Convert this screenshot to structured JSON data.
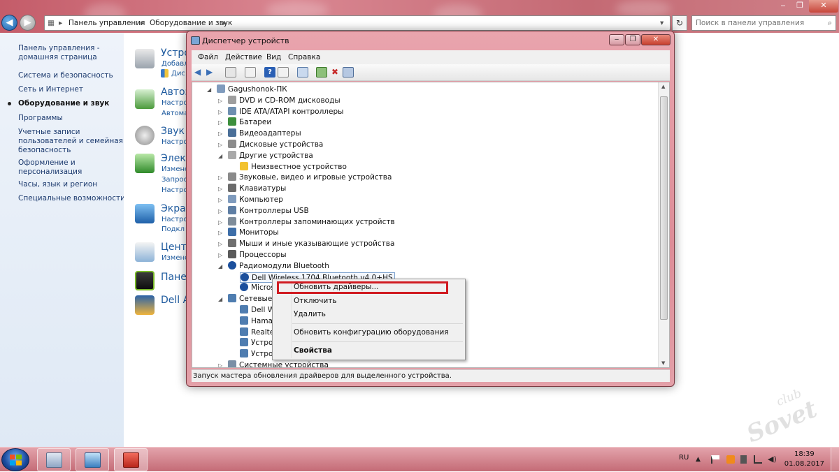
{
  "explorer": {
    "breadcrumb": [
      "Панель управления",
      "Оборудование и звук"
    ],
    "search_placeholder": "Поиск в панели управления"
  },
  "sidebar": {
    "items": [
      {
        "label": "Панель управления -"
      },
      {
        "label": "домашняя страница"
      },
      {
        "label": "Система и безопасность"
      },
      {
        "label": "Сеть и Интернет"
      },
      {
        "label": "Оборудование и звук",
        "active": true
      },
      {
        "label": "Программы"
      },
      {
        "label": "Учетные записи"
      },
      {
        "label": "пользователей и семейная"
      },
      {
        "label": "безопасность"
      },
      {
        "label": "Оформление и"
      },
      {
        "label": "персонализация"
      },
      {
        "label": "Часы, язык и регион"
      },
      {
        "label": "Специальные возможности"
      }
    ]
  },
  "categories": [
    {
      "title": "Устро",
      "links": [
        "Добавл",
        "Дис"
      ],
      "icon": "printer-icon"
    },
    {
      "title": "Автоз",
      "links": [
        "Настро",
        "Автома"
      ],
      "icon": "autoplay-icon"
    },
    {
      "title": "Звук",
      "links": [
        "Настро"
      ],
      "icon": "speaker-icon"
    },
    {
      "title": "Электр",
      "links": [
        "Изменс",
        "Запрос",
        "Настро"
      ],
      "icon": "battery-icon"
    },
    {
      "title": "Экран",
      "links": [
        "Настро",
        "Подкл"
      ],
      "icon": "display-icon"
    },
    {
      "title": "Центр",
      "links": [
        "Изменс"
      ],
      "icon": "mobility-center-icon"
    },
    {
      "title": "Панел",
      "links": [],
      "icon": "nvidia-icon"
    },
    {
      "title": "Dell A",
      "links": [],
      "icon": "dell-audio-icon"
    }
  ],
  "device_manager": {
    "title": "Диспетчер устройств",
    "menu": [
      "Файл",
      "Действие",
      "Вид",
      "Справка"
    ],
    "tree": [
      {
        "label": "Gagushonok-ПК",
        "level": 0,
        "expanded": true,
        "icon": "computer-icon"
      },
      {
        "label": "DVD и CD-ROM дисководы",
        "level": 1,
        "icon": "dvd-icon"
      },
      {
        "label": "IDE ATA/ATAPI контроллеры",
        "level": 1,
        "icon": "ide-controller-icon"
      },
      {
        "label": "Батареи",
        "level": 1,
        "icon": "battery-icon"
      },
      {
        "label": "Видеоадаптеры",
        "level": 1,
        "icon": "video-adapter-icon"
      },
      {
        "label": "Дисковые устройства",
        "level": 1,
        "icon": "disk-icon"
      },
      {
        "label": "Другие устройства",
        "level": 1,
        "expanded": true,
        "icon": "unknown-device-icon"
      },
      {
        "label": "Неизвестное устройство",
        "level": 2,
        "icon": "warning-device-icon"
      },
      {
        "label": "Звуковые, видео и игровые устройства",
        "level": 1,
        "icon": "sound-device-icon"
      },
      {
        "label": "Клавиатуры",
        "level": 1,
        "icon": "keyboard-icon"
      },
      {
        "label": "Компьютер",
        "level": 1,
        "icon": "computer-icon"
      },
      {
        "label": "Контроллеры USB",
        "level": 1,
        "icon": "usb-icon"
      },
      {
        "label": "Контроллеры запоминающих устройств",
        "level": 1,
        "icon": "storage-controller-icon"
      },
      {
        "label": "Мониторы",
        "level": 1,
        "icon": "monitor-icon"
      },
      {
        "label": "Мыши и иные указывающие устройства",
        "level": 1,
        "icon": "mouse-icon"
      },
      {
        "label": "Процессоры",
        "level": 1,
        "icon": "processor-icon"
      },
      {
        "label": "Радиомодули Bluetooth",
        "level": 1,
        "expanded": true,
        "icon": "bluetooth-icon"
      },
      {
        "label": "Dell Wireless 1704 Bluetooth v4.0+HS",
        "level": 2,
        "selected": true,
        "icon": "bluetooth-icon"
      },
      {
        "label": "Microsoft",
        "level": 2,
        "icon": "bluetooth-icon"
      },
      {
        "label": "Сетевые ада",
        "level": 1,
        "expanded": true,
        "icon": "network-adapter-icon"
      },
      {
        "label": "Dell Wirel",
        "level": 2,
        "icon": "network-adapter-icon"
      },
      {
        "label": "Hamachi",
        "level": 2,
        "icon": "network-adapter-icon"
      },
      {
        "label": "Realtek P",
        "level": 2,
        "icon": "network-adapter-icon"
      },
      {
        "label": "Устройст",
        "level": 2,
        "icon": "network-adapter-icon"
      },
      {
        "label": "Устройст",
        "level": 2,
        "icon": "network-adapter-icon"
      },
      {
        "label": "Системные устройства",
        "level": 1,
        "icon": "system-device-icon"
      }
    ],
    "status": "Запуск мастера обновления драйверов для выделенного устройства."
  },
  "context_menu": {
    "items": [
      "Обновить драйверы...",
      "Отключить",
      "Удалить",
      "Обновить конфигурацию оборудования",
      "Свойства"
    ]
  },
  "taskbar": {
    "language": "RU",
    "time": "18:39",
    "date": "01.08.2017"
  },
  "watermark": {
    "line1": "club",
    "line2": "Sovet"
  },
  "colors": {
    "highlight_box": "#d01b21",
    "aero_frame": "#d98691",
    "link": "#1e5a9e"
  }
}
